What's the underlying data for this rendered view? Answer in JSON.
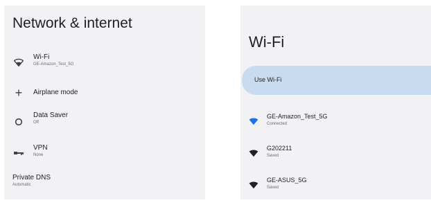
{
  "network": {
    "title": "Network & internet",
    "items": [
      {
        "label": "Wi-Fi",
        "sub": "GE-Amazon_Test_5G",
        "icon": "wifi-icon"
      },
      {
        "label": "Airplane mode",
        "sub": "",
        "icon": "airplane-icon"
      },
      {
        "label": "Data Saver",
        "sub": "Off",
        "icon": "data-saver-icon"
      },
      {
        "label": "VPN",
        "sub": "None",
        "icon": "vpn-icon"
      },
      {
        "label": "Private DNS",
        "sub": "Automatic",
        "icon": ""
      }
    ]
  },
  "wifi": {
    "title": "Wi-Fi",
    "use_wifi_label": "Use Wi-Fi",
    "networks": [
      {
        "name": "GE-Amazon_Test_5G",
        "status": "Connected",
        "icon": "wifi-signal-icon"
      },
      {
        "name": "G202211",
        "status": "Saved",
        "icon": "wifi-signal-icon"
      },
      {
        "name": "GE-ASUS_5G",
        "status": "Saved",
        "icon": "wifi-signal-icon"
      }
    ]
  },
  "colors": {
    "panel_bg": "#f2f2f5",
    "use_wifi_bg": "#c9dcef",
    "connected_icon": "#1a73e8",
    "saved_icon": "#202124"
  }
}
